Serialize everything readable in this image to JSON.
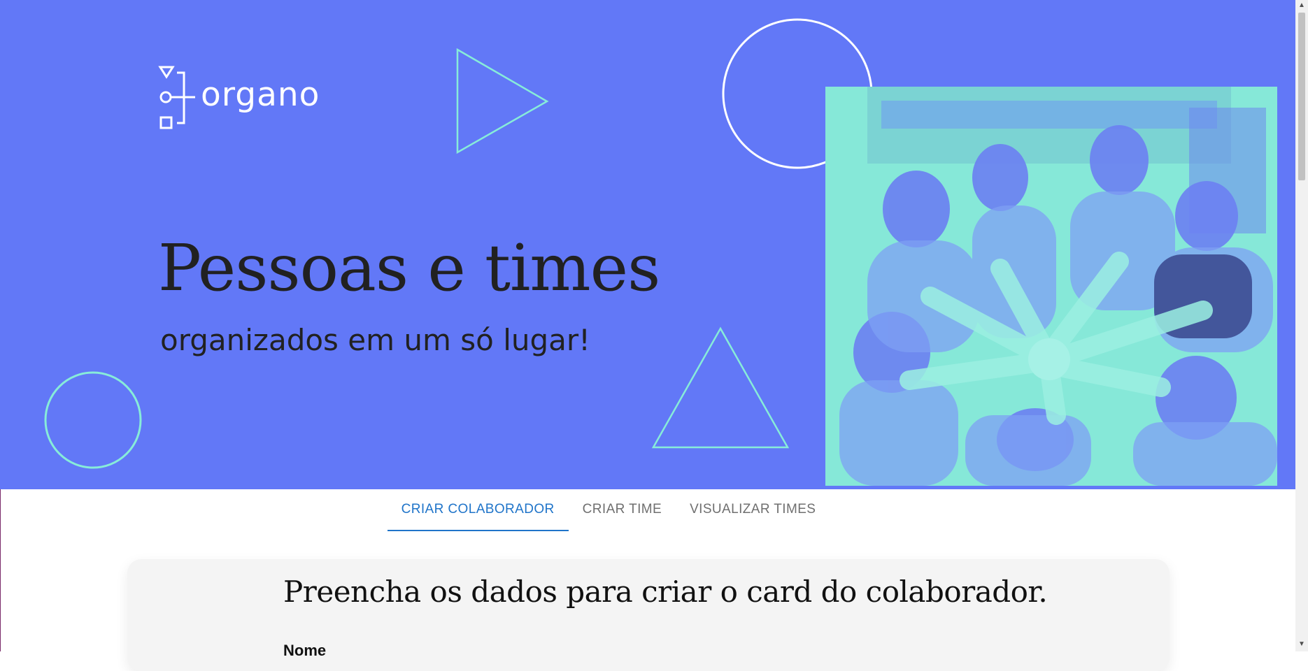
{
  "brand": {
    "name": "organo"
  },
  "hero": {
    "title": "Pessoas e times",
    "subtitle": "organizados em um só lugar!"
  },
  "tabs": [
    {
      "label": "CRIAR COLABORADOR",
      "active": true
    },
    {
      "label": "CRIAR TIME",
      "active": false
    },
    {
      "label": "VISUALIZAR TIMES",
      "active": false
    }
  ],
  "form": {
    "heading": "Preencha os dados para criar o card do colaborador.",
    "fields": [
      {
        "label": "Nome"
      }
    ]
  },
  "colors": {
    "banner": "#6278f7",
    "accent_mint": "#87ecd9",
    "tab_active": "#1f74c9",
    "tab_inactive": "#6f6f6f",
    "card_bg": "#f4f4f4"
  },
  "icons": {
    "logo_mark": "organo-logo-icon",
    "hero_image": "team-hands-photo"
  }
}
